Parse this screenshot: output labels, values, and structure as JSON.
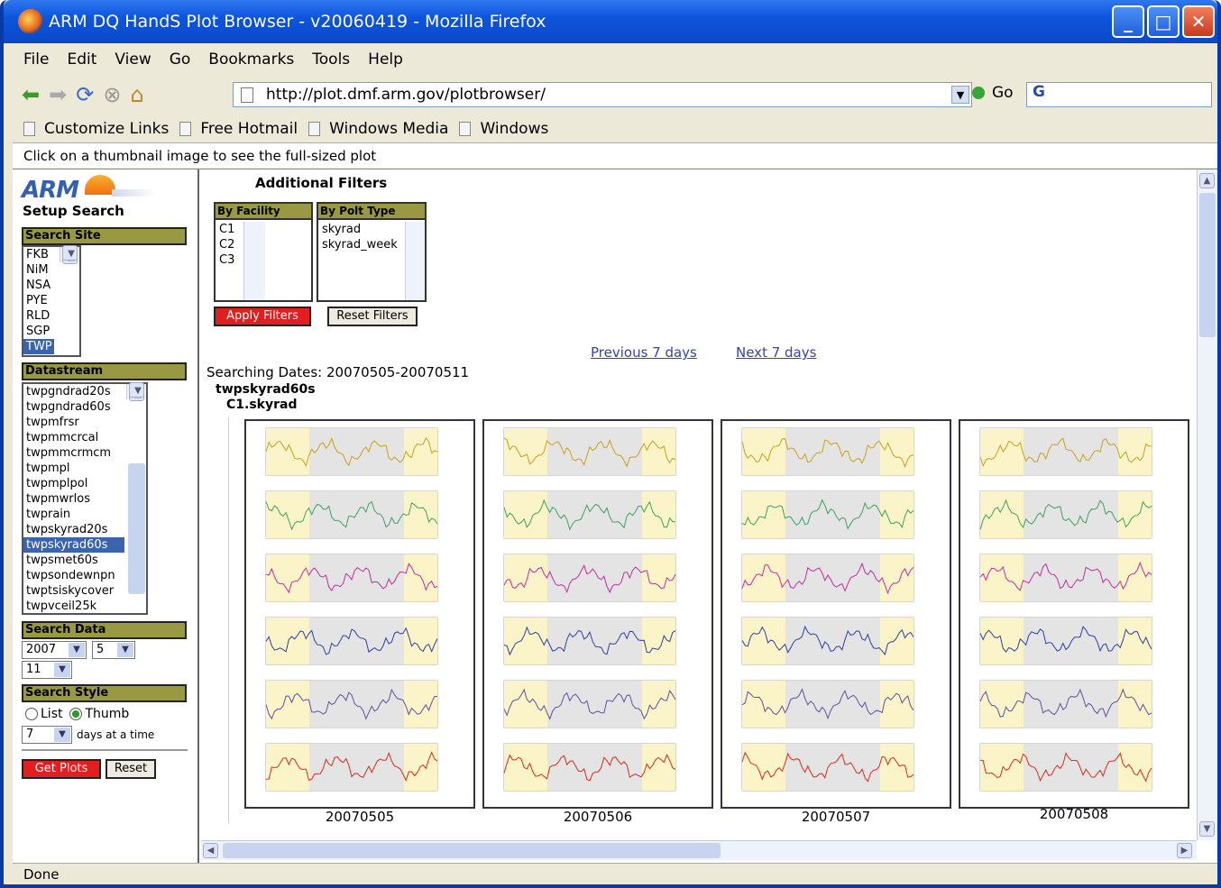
{
  "window": {
    "title": "ARM DQ HandS Plot Browser - v20060419 - Mozilla Firefox"
  },
  "menu": [
    "File",
    "Edit",
    "View",
    "Go",
    "Bookmarks",
    "Tools",
    "Help"
  ],
  "nav": {
    "url": "http://plot.dmf.arm.gov/plotbrowser/",
    "go_label": "Go",
    "search_value": "G"
  },
  "bookmarks": [
    "Customize Links",
    "Free Hotmail",
    "Windows Media",
    "Windows"
  ],
  "info_text": "Click on a thumbnail image to see the full-sized plot",
  "left": {
    "logo_text": "ARM",
    "setup_title": "Setup Search",
    "search_site": {
      "header": "Search Site",
      "items": [
        "FKB",
        "NiM",
        "NSA",
        "PYE",
        "RLD",
        "SGP",
        "TWP"
      ],
      "selected": "TWP"
    },
    "datastream": {
      "header": "Datastream",
      "items": [
        "twpgndrad20s",
        "twpgndrad60s",
        "twpmfrsr",
        "twpmmcrcal",
        "twpmmcrmcm",
        "twpmpl",
        "twpmplpol",
        "twpmwrlos",
        "twprain",
        "twpskyrad20s",
        "twpskyrad60s",
        "twpsmet60s",
        "twpsondewnpn",
        "twptsiskycover",
        "twpvceil25k"
      ],
      "selected": "twpskyrad60s"
    },
    "search_data": {
      "header": "Search Data",
      "year": "2007",
      "month": "5",
      "day": "11"
    },
    "search_style": {
      "header": "Search Style",
      "list_label": "List",
      "thumb_label": "Thumb",
      "selected": "Thumb",
      "days": "7",
      "days_label": "days at a time"
    },
    "get_plots_label": "Get Plots",
    "reset_label": "Reset"
  },
  "filters": {
    "title": "Additional Filters",
    "facility": {
      "header": "By Facility",
      "items": [
        "C1",
        "C2",
        "C3"
      ]
    },
    "plot_type": {
      "header": "By Polt Type",
      "items": [
        "skyrad",
        "skyrad_week"
      ]
    },
    "apply_label": "Apply Filters",
    "reset_label": "Reset Filters"
  },
  "results": {
    "prev_label": "Previous 7 days",
    "next_label": "Next 7 days",
    "searching_dates": "Searching Dates: 20070505-20070511",
    "datastream": "twpskyrad60s",
    "facility_plot": "C1.skyrad",
    "thumbnails": [
      "20070505",
      "20070506",
      "20070507",
      "20070508"
    ]
  },
  "status": "Done"
}
